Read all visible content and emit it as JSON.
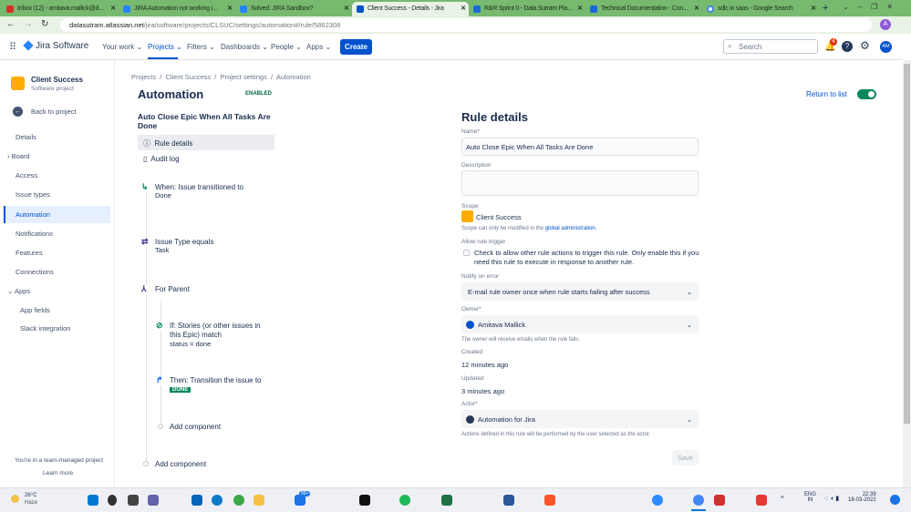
{
  "browser": {
    "tabs": [
      "Inbox (12) - amitava.mallick@d...",
      "JIRA Automation not working i...",
      "Solved: JIRA Sandbox?",
      "Client Success - Details - Jira",
      "R&R Sprint 0 - Data Sutram Pla...",
      "Technical Documentation - Con...",
      "sdlc in saas - Google Search"
    ],
    "url_host": "datasutram.atlassian.net",
    "url_path": "/jira/software/projects/CLSUC/settings/automation#/rule/5862308",
    "profile": "A"
  },
  "nav": {
    "product": "Jira Software",
    "items": [
      "Your work",
      "Projects",
      "Filters",
      "Dashboards",
      "People",
      "Apps"
    ],
    "create": "Create",
    "search_placeholder": "Search",
    "notif_count": "4",
    "avatar": "AM"
  },
  "sidebar": {
    "project": "Client Success",
    "project_type": "Software project",
    "back": "Back to project",
    "items": [
      "Details",
      "Board",
      "Access",
      "Issue types",
      "Automation",
      "Notifications",
      "Features",
      "Connections",
      "Apps",
      "App fields",
      "Slack integration"
    ],
    "footer": "You're in a team-managed project",
    "learn_more": "Learn more"
  },
  "breadcrumb": [
    "Projects",
    "Client Success",
    "Project settings",
    "Automation"
  ],
  "page": {
    "title": "Automation",
    "status": "ENABLED",
    "return": "Return to list",
    "enabled": true
  },
  "rule": {
    "name": "Auto Close Epic When All Tasks Are Done",
    "menu": [
      "Rule details",
      "Audit log"
    ],
    "components": {
      "when": "When: Issue transitioned to",
      "when_value": "Done",
      "cond": "Issue Type equals",
      "cond_value": "Task",
      "branch": "For Parent",
      "if": "If: Stories (or other issues in this Epic) match",
      "if_value": "status = done",
      "then": "Then: Transition the issue to",
      "then_value": "DONE",
      "add_inner": "Add component",
      "add_outer": "Add component"
    }
  },
  "details": {
    "title": "Rule details",
    "name_label": "Name*",
    "name_value": "Auto Close Epic When All Tasks Are Done",
    "desc_label": "Description",
    "scope_label": "Scope",
    "scope_value": "Client Success",
    "scope_note": "Scope can only be modified in the",
    "scope_link": "global administration.",
    "allow_label": "Allow rule trigger",
    "allow_text": "Check to allow other rule actions to trigger this rule. Only enable this if you need this rule to execute in response to another rule.",
    "notify_label": "Notify on error",
    "notify_value": "E-mail rule owner once when rule starts failing after success",
    "owner_label": "Owner*",
    "owner_value": "Amitava Mallick",
    "owner_note": "The owner will receive emails when the rule fails.",
    "created_label": "Created",
    "created_value": "12 minutes ago",
    "updated_label": "Updated",
    "updated_value": "3 minutes ago",
    "actor_label": "Actor*",
    "actor_value": "Automation for Jira",
    "actor_note": "Actions defined in this rule will be performed by the user selected as the actor.",
    "save": "Save"
  },
  "taskbar": {
    "temp": "26°C",
    "weather": "Haze",
    "lang": "ENG",
    "region": "IN",
    "time": "22:39",
    "date": "18-03-2022",
    "badge": "99+"
  }
}
